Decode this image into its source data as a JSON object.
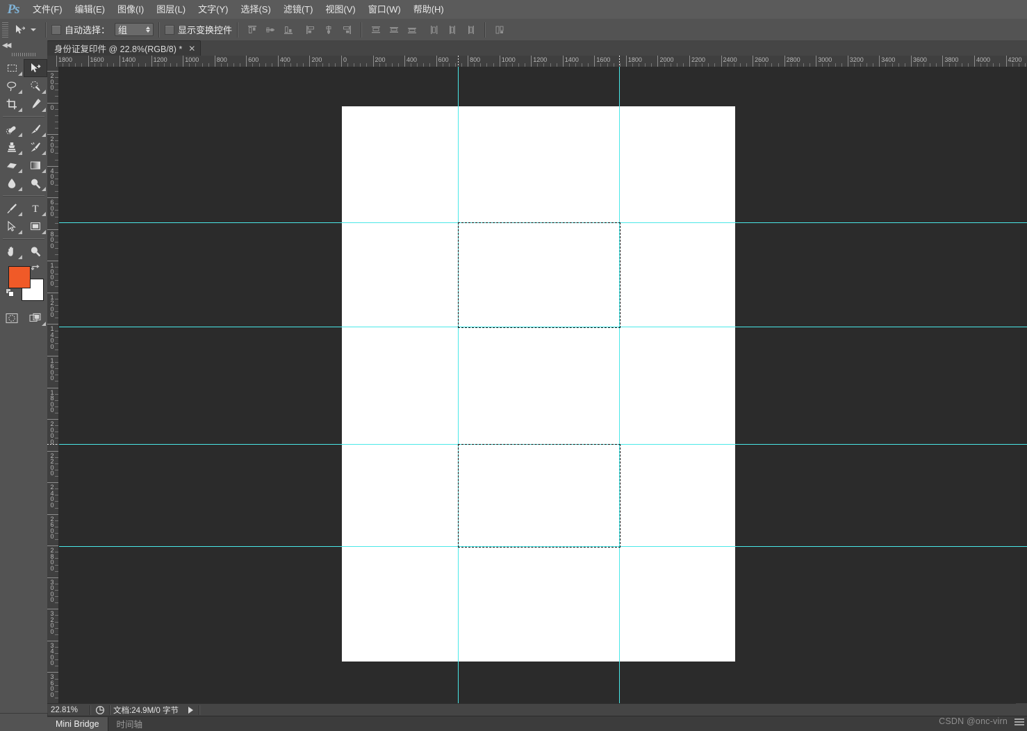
{
  "app": {
    "name": "Adobe Photoshop",
    "logo_text": "Ps"
  },
  "menubar": {
    "items": [
      {
        "label": "文件(F)",
        "name": "menu-file"
      },
      {
        "label": "编辑(E)",
        "name": "menu-edit"
      },
      {
        "label": "图像(I)",
        "name": "menu-image"
      },
      {
        "label": "图层(L)",
        "name": "menu-layer"
      },
      {
        "label": "文字(Y)",
        "name": "menu-type"
      },
      {
        "label": "选择(S)",
        "name": "menu-select"
      },
      {
        "label": "滤镜(T)",
        "name": "menu-filter"
      },
      {
        "label": "视图(V)",
        "name": "menu-view"
      },
      {
        "label": "窗口(W)",
        "name": "menu-window"
      },
      {
        "label": "帮助(H)",
        "name": "menu-help"
      }
    ]
  },
  "options_bar": {
    "active_tool": "move-tool",
    "auto_select_label": "自动选择：",
    "auto_select_checked": false,
    "auto_select_value": "组",
    "auto_select_options": [
      "组",
      "图层"
    ],
    "show_transform_label": "显示变换控件",
    "show_transform_checked": false,
    "align_buttons": [
      {
        "name": "align-top-edges"
      },
      {
        "name": "align-vertical-centers"
      },
      {
        "name": "align-bottom-edges"
      },
      {
        "name": "align-left-edges"
      },
      {
        "name": "align-horizontal-centers"
      },
      {
        "name": "align-right-edges"
      }
    ],
    "distribute_buttons": [
      {
        "name": "distribute-top-edges"
      },
      {
        "name": "distribute-vertical-centers"
      },
      {
        "name": "distribute-bottom-edges"
      },
      {
        "name": "distribute-left-edges"
      },
      {
        "name": "distribute-horizontal-centers"
      },
      {
        "name": "distribute-right-edges"
      }
    ],
    "auto_align_button": {
      "name": "auto-align-layers"
    }
  },
  "document_tab": {
    "title": "身份证复印件 @ 22.8%(RGB/8) *",
    "close_glyph": "✕",
    "modified": true
  },
  "toolbox": {
    "collapse_glyph": "◀◀",
    "tools": [
      {
        "name": "rectangular-marquee-tool",
        "selected": false,
        "has_flyout": true
      },
      {
        "name": "move-tool",
        "selected": true,
        "has_flyout": false
      },
      {
        "name": "lasso-tool",
        "selected": false,
        "has_flyout": true
      },
      {
        "name": "quick-selection-tool",
        "selected": false,
        "has_flyout": true
      },
      {
        "name": "crop-tool",
        "selected": false,
        "has_flyout": true
      },
      {
        "name": "eyedropper-tool",
        "selected": false,
        "has_flyout": true
      },
      {
        "name": "spot-healing-brush-tool",
        "selected": false,
        "has_flyout": true
      },
      {
        "name": "brush-tool",
        "selected": false,
        "has_flyout": true
      },
      {
        "name": "clone-stamp-tool",
        "selected": false,
        "has_flyout": true
      },
      {
        "name": "history-brush-tool",
        "selected": false,
        "has_flyout": true
      },
      {
        "name": "eraser-tool",
        "selected": false,
        "has_flyout": true
      },
      {
        "name": "gradient-tool",
        "selected": false,
        "has_flyout": true
      },
      {
        "name": "blur-tool",
        "selected": false,
        "has_flyout": true
      },
      {
        "name": "dodge-tool",
        "selected": false,
        "has_flyout": true
      },
      {
        "name": "pen-tool",
        "selected": false,
        "has_flyout": true
      },
      {
        "name": "horizontal-type-tool",
        "selected": false,
        "has_flyout": true
      },
      {
        "name": "path-selection-tool",
        "selected": false,
        "has_flyout": true
      },
      {
        "name": "rectangle-tool",
        "selected": false,
        "has_flyout": true
      },
      {
        "name": "hand-tool",
        "selected": false,
        "has_flyout": true
      },
      {
        "name": "zoom-tool",
        "selected": false,
        "has_flyout": false
      }
    ],
    "foreground_color": "#F05A28",
    "background_color": "#FFFFFF",
    "quick_mask": {
      "name": "quick-mask-mode"
    },
    "screen_mode": {
      "name": "screen-mode-toggle"
    }
  },
  "rulers": {
    "units": "px",
    "horizontal_labels": [
      "1800",
      "1600",
      "1400",
      "1200",
      "1000",
      "800",
      "600",
      "400",
      "200",
      "0",
      "200",
      "400",
      "600",
      "800",
      "1000",
      "1200",
      "1400",
      "1600",
      "1800",
      "2000",
      "2200",
      "2400",
      "2600",
      "2800",
      "3000",
      "3200",
      "3400",
      "3600",
      "3800",
      "4000",
      "4200"
    ],
    "vertical_labels": [
      "200",
      "0",
      "200",
      "400",
      "600",
      "800",
      "1000",
      "1200",
      "1400",
      "1600",
      "1800",
      "2000",
      "2200",
      "2400",
      "2600",
      "2800",
      "3000",
      "3200",
      "3400",
      "3600"
    ]
  },
  "canvas": {
    "zoom_percent": "22.8%",
    "artboard_color": "#FFFFFF",
    "guide_color": "#4AE8E8",
    "selection_style": "dashed",
    "vertical_guides": [
      "1600",
      "2000"
    ],
    "horizontal_guides": [
      "1000",
      "1600",
      "2000",
      "2600"
    ],
    "marquee_count": 2
  },
  "status_bar": {
    "zoom_value": "22.81%",
    "doc_icon": {
      "name": "document-size-icon"
    },
    "doc_info": "文档:24.9M/0 字节",
    "play_glyph": "▶"
  },
  "bottom_panels": {
    "tabs": [
      {
        "label": "Mini Bridge",
        "active": true,
        "name": "tab-mini-bridge"
      },
      {
        "label": "时间轴",
        "active": false,
        "name": "tab-timeline"
      }
    ]
  },
  "watermark": {
    "text": "CSDN @onc-virn"
  }
}
